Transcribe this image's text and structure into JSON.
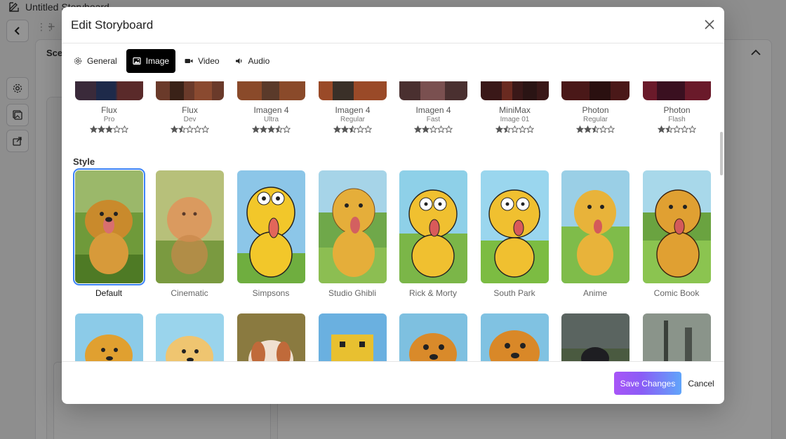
{
  "background": {
    "doc_title": "Untitled Storyboard",
    "panel_title": "Sce"
  },
  "modal": {
    "title": "Edit Storyboard",
    "tabs": [
      {
        "label": "General",
        "icon": "gear-icon",
        "active": false
      },
      {
        "label": "Image",
        "icon": "image-icon",
        "active": true
      },
      {
        "label": "Video",
        "icon": "video-camera-icon",
        "active": false
      },
      {
        "label": "Audio",
        "icon": "speaker-icon",
        "active": false
      }
    ],
    "models": [
      {
        "name": "Flux",
        "variant": "Pro",
        "rating": 3
      },
      {
        "name": "Flux",
        "variant": "Dev",
        "rating": 1.5
      },
      {
        "name": "Imagen 4",
        "variant": "Ultra",
        "rating": 3.5
      },
      {
        "name": "Imagen 4",
        "variant": "Regular",
        "rating": 2.5
      },
      {
        "name": "Imagen 4",
        "variant": "Fast",
        "rating": 2
      },
      {
        "name": "MiniMax",
        "variant": "Image 01",
        "rating": 1.5
      },
      {
        "name": "Photon",
        "variant": "Regular",
        "rating": 2.5
      },
      {
        "name": "Photon",
        "variant": "Flash",
        "rating": 1.5
      }
    ],
    "style_section_title": "Style",
    "styles": [
      {
        "label": "Default",
        "selected": true
      },
      {
        "label": "Cinematic",
        "selected": false
      },
      {
        "label": "Simpsons",
        "selected": false
      },
      {
        "label": "Studio Ghibli",
        "selected": false
      },
      {
        "label": "Rick & Morty",
        "selected": false
      },
      {
        "label": "South Park",
        "selected": false
      },
      {
        "label": "Anime",
        "selected": false
      },
      {
        "label": "Comic Book",
        "selected": false
      }
    ],
    "save_label": "Save Changes",
    "cancel_label": "Cancel"
  },
  "colors": {
    "accent_selected": "#3b82f6",
    "active_tab_bg": "#000000",
    "save_gradient_start": "#a855f7",
    "save_gradient_end": "#60a5fa"
  }
}
